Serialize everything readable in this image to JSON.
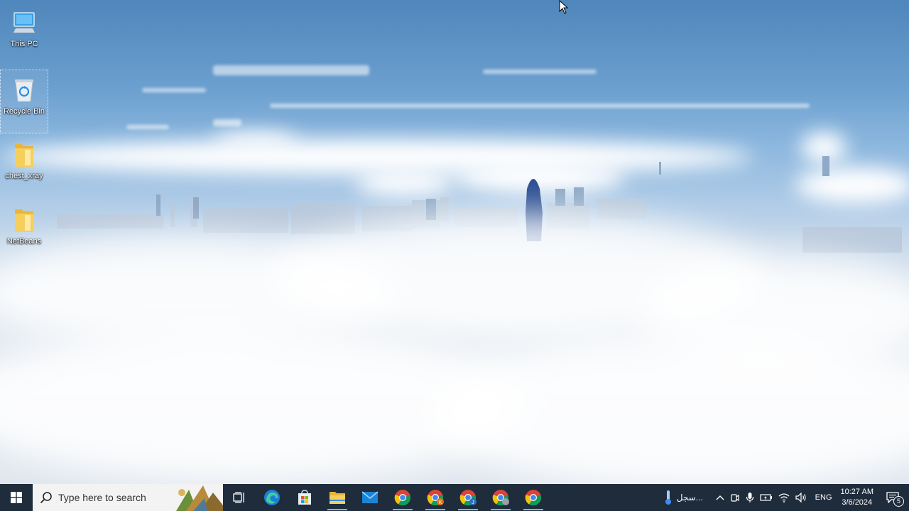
{
  "desktop": {
    "icons": [
      {
        "label": "This PC"
      },
      {
        "label": "Recycle Bin"
      },
      {
        "label": "chest_xray"
      },
      {
        "label": "NetBeans"
      }
    ]
  },
  "taskbar": {
    "search_placeholder": "Type here to search",
    "apps": [
      {
        "icon": "task-view-icon"
      },
      {
        "icon": "edge-icon"
      },
      {
        "icon": "store-icon"
      },
      {
        "icon": "file-explorer-icon"
      },
      {
        "icon": "mail-icon"
      },
      {
        "icon": "chrome-icon"
      },
      {
        "icon": "chrome-profile-k-icon",
        "badge": "K"
      },
      {
        "icon": "chrome-profile-j-icon",
        "badge": "J"
      },
      {
        "icon": "chrome-profile-icon"
      },
      {
        "icon": "chrome-icon"
      }
    ],
    "tray": {
      "weather_text": "سجل...",
      "language": "ENG",
      "time": "10:27 AM",
      "date": "3/6/2024",
      "notification_count": "5"
    }
  },
  "colors": {
    "taskbar": "#1f2c3c",
    "accent": "#7ab3e6",
    "folder": "#f2c94c"
  }
}
